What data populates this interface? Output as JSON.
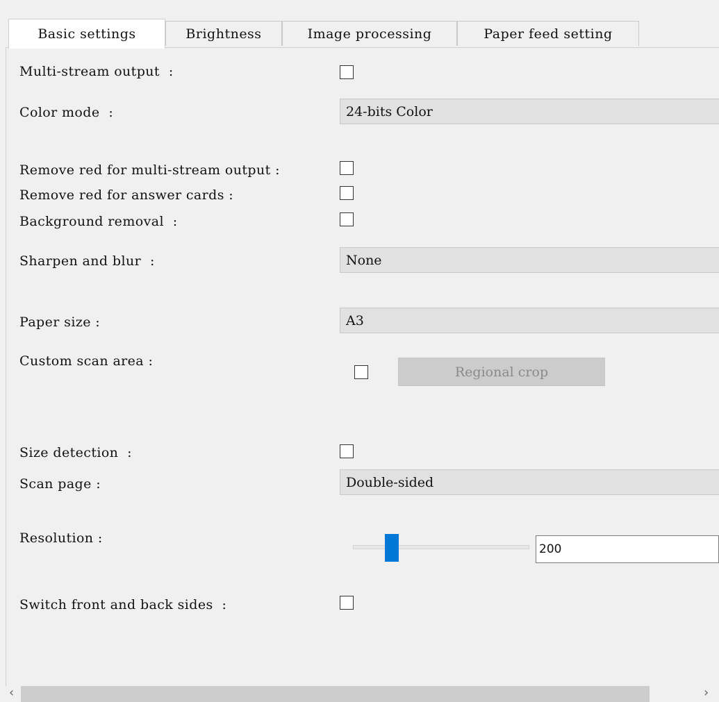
{
  "tabs": [
    {
      "label": "Basic settings",
      "active": true
    },
    {
      "label": "Brightness",
      "active": false
    },
    {
      "label": "Image processing",
      "active": false
    },
    {
      "label": "Paper feed setting",
      "active": false
    }
  ],
  "settings": {
    "multi_stream_label": "Multi-stream output  :",
    "multi_stream_checked": false,
    "color_mode_label": "Color mode  :",
    "color_mode_value": "24-bits Color",
    "remove_red_multi_label": "Remove red for multi-stream output :",
    "remove_red_multi_checked": false,
    "remove_red_cards_label": "Remove red for answer cards :",
    "remove_red_cards_checked": false,
    "background_removal_label": "Background removal  :",
    "background_removal_checked": false,
    "sharpen_label": "Sharpen and blur  :",
    "sharpen_value": "None",
    "paper_size_label": "Paper size :",
    "paper_size_value": "A3",
    "custom_scan_label": "Custom scan area :",
    "custom_scan_checked": false,
    "regional_crop_label": "Regional crop",
    "size_detection_label": "Size detection  :",
    "size_detection_checked": false,
    "scan_page_label": "Scan page :",
    "scan_page_value": "Double-sided",
    "resolution_label": "Resolution :",
    "resolution_value": "200",
    "resolution_slider_fraction": 0.22,
    "switch_sides_label": "Switch front and back sides  :",
    "switch_sides_checked": false
  },
  "scrollbar": {
    "left_arrow": "‹",
    "right_arrow": "›"
  },
  "colors": {
    "accent": "#0078d7",
    "panel_bg": "#f0f0f0",
    "select_bg": "#e1e1e1"
  }
}
